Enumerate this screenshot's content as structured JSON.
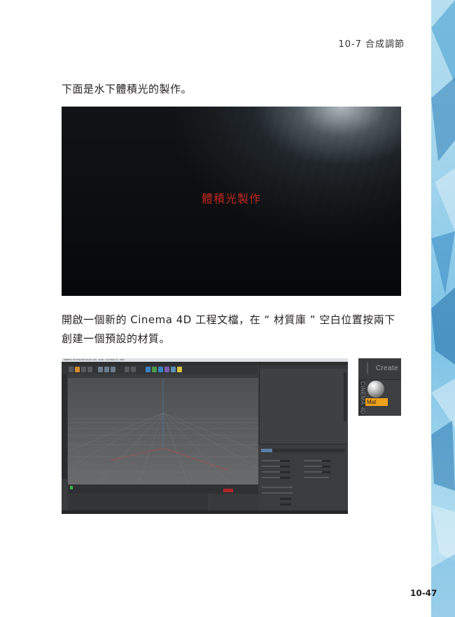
{
  "header": {
    "section": "10-7  合成調節"
  },
  "paragraphs": {
    "intro": "下面是水下體積光的製作。",
    "steps": "開啟一個新的 Cinema 4D 工程文檔，在 “ 材質庫 ” 空白位置按兩下創建一個預設的材質。"
  },
  "figure_light": {
    "caption": "體積光製作"
  },
  "figure_c4d": {
    "title": "CINEMA 4D R19.024 Studio (RC - R19) - [Untitled 2] - Main"
  },
  "figure_material": {
    "create_label": "Create",
    "side_label": "CINEMA 4D",
    "material_name": "Mat"
  },
  "page_number": "10-47"
}
